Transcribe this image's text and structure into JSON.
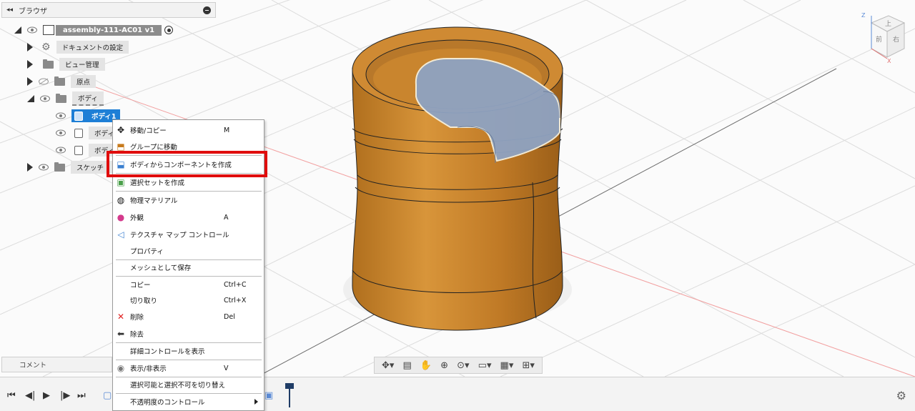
{
  "browser": {
    "collapse_glyph": "◂◂",
    "title": "ブラウザ",
    "root": {
      "label": "assembly-111-AC01 v1"
    },
    "items": [
      {
        "label": "ドキュメントの設定",
        "icon": "gear-icon"
      },
      {
        "label": "ビュー管理",
        "icon": "folder-icon"
      },
      {
        "label": "原点",
        "icon": "folder-icon"
      },
      {
        "label": "ボディ",
        "icon": "folder-icon"
      },
      {
        "label": "ボディ1",
        "icon": "body-icon",
        "selected": true
      },
      {
        "label": "ボディ",
        "icon": "body-icon"
      },
      {
        "label": "ボディ",
        "icon": "body-icon"
      },
      {
        "label": "スケッチ",
        "icon": "folder-icon"
      }
    ]
  },
  "context_menu": {
    "items": [
      {
        "label": "移動/コピー",
        "shortcut": "M",
        "icon": "move-icon"
      },
      {
        "label": "グループに移動",
        "shortcut": "",
        "icon": "group-icon"
      },
      {
        "label": "ボディからコンポーネントを作成",
        "shortcut": "",
        "icon": "component-icon"
      },
      {
        "label": "選択セットを作成",
        "shortcut": "",
        "icon": "selection-set-icon"
      },
      {
        "label": "物理マテリアル",
        "shortcut": "",
        "icon": "material-icon"
      },
      {
        "label": "外観",
        "shortcut": "A",
        "icon": "appearance-icon"
      },
      {
        "label": "テクスチャ マップ コントロール",
        "shortcut": "",
        "icon": "texture-icon"
      },
      {
        "label": "プロパティ",
        "shortcut": ""
      },
      {
        "label": "メッシュとして保存",
        "shortcut": ""
      },
      {
        "label": "コピー",
        "shortcut": "Ctrl+C"
      },
      {
        "label": "切り取り",
        "shortcut": "Ctrl+X"
      },
      {
        "label": "削除",
        "shortcut": "Del",
        "icon": "delete-icon"
      },
      {
        "label": "除去",
        "shortcut": "",
        "icon": "remove-icon"
      },
      {
        "label": "詳細コントロールを表示",
        "shortcut": ""
      },
      {
        "label": "表示/非表示",
        "shortcut": "V",
        "icon": "eye-icon"
      },
      {
        "label": "選択可能と選択不可を切り替え",
        "shortcut": ""
      },
      {
        "label": "不透明度のコントロール",
        "shortcut": "",
        "submenu": true
      }
    ]
  },
  "comment": {
    "label": "コメント"
  },
  "viewcube": {
    "top": "上",
    "front": "前",
    "right": "右",
    "axis_z": "Z",
    "axis_x": "X"
  },
  "colors": {
    "highlight": "#e00d0d",
    "body": "#c9852e",
    "selected_face": "#8fa3c2",
    "selection": "#1e7fd6"
  }
}
